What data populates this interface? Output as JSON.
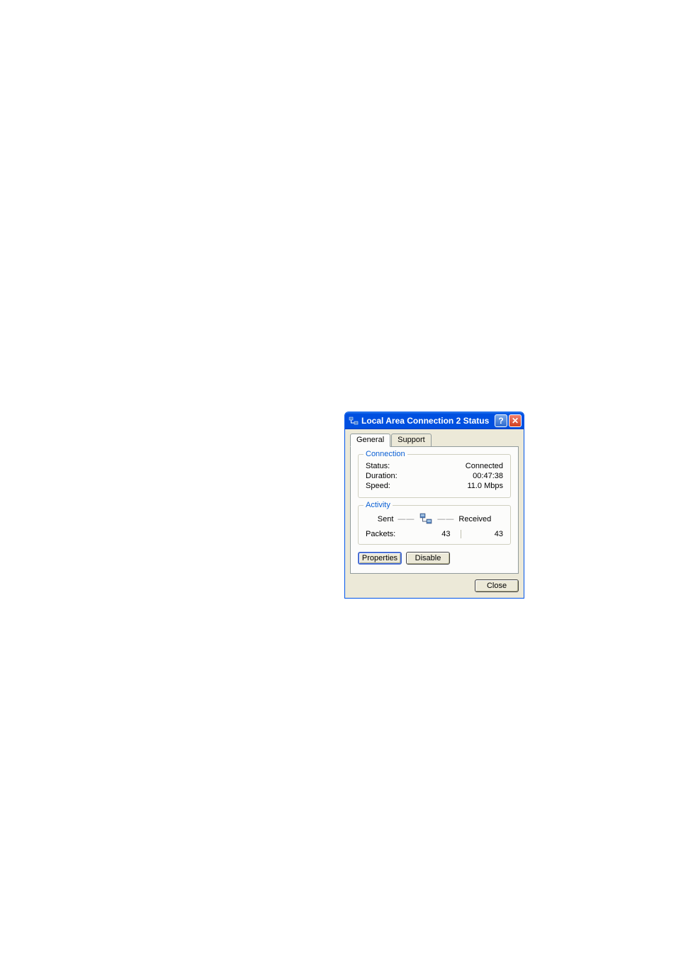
{
  "dialog": {
    "title": "Local Area Connection 2 Status",
    "tabs": {
      "general": "General",
      "support": "Support"
    },
    "connection": {
      "legend": "Connection",
      "status_label": "Status:",
      "status_value": "Connected",
      "duration_label": "Duration:",
      "duration_value": "00:47:38",
      "speed_label": "Speed:",
      "speed_value": "11.0 Mbps"
    },
    "activity": {
      "legend": "Activity",
      "sent_label": "Sent",
      "received_label": "Received",
      "packets_label": "Packets:",
      "packets_sent": "43",
      "packets_received": "43"
    },
    "buttons": {
      "properties": "Properties",
      "disable": "Disable",
      "close": "Close"
    }
  }
}
